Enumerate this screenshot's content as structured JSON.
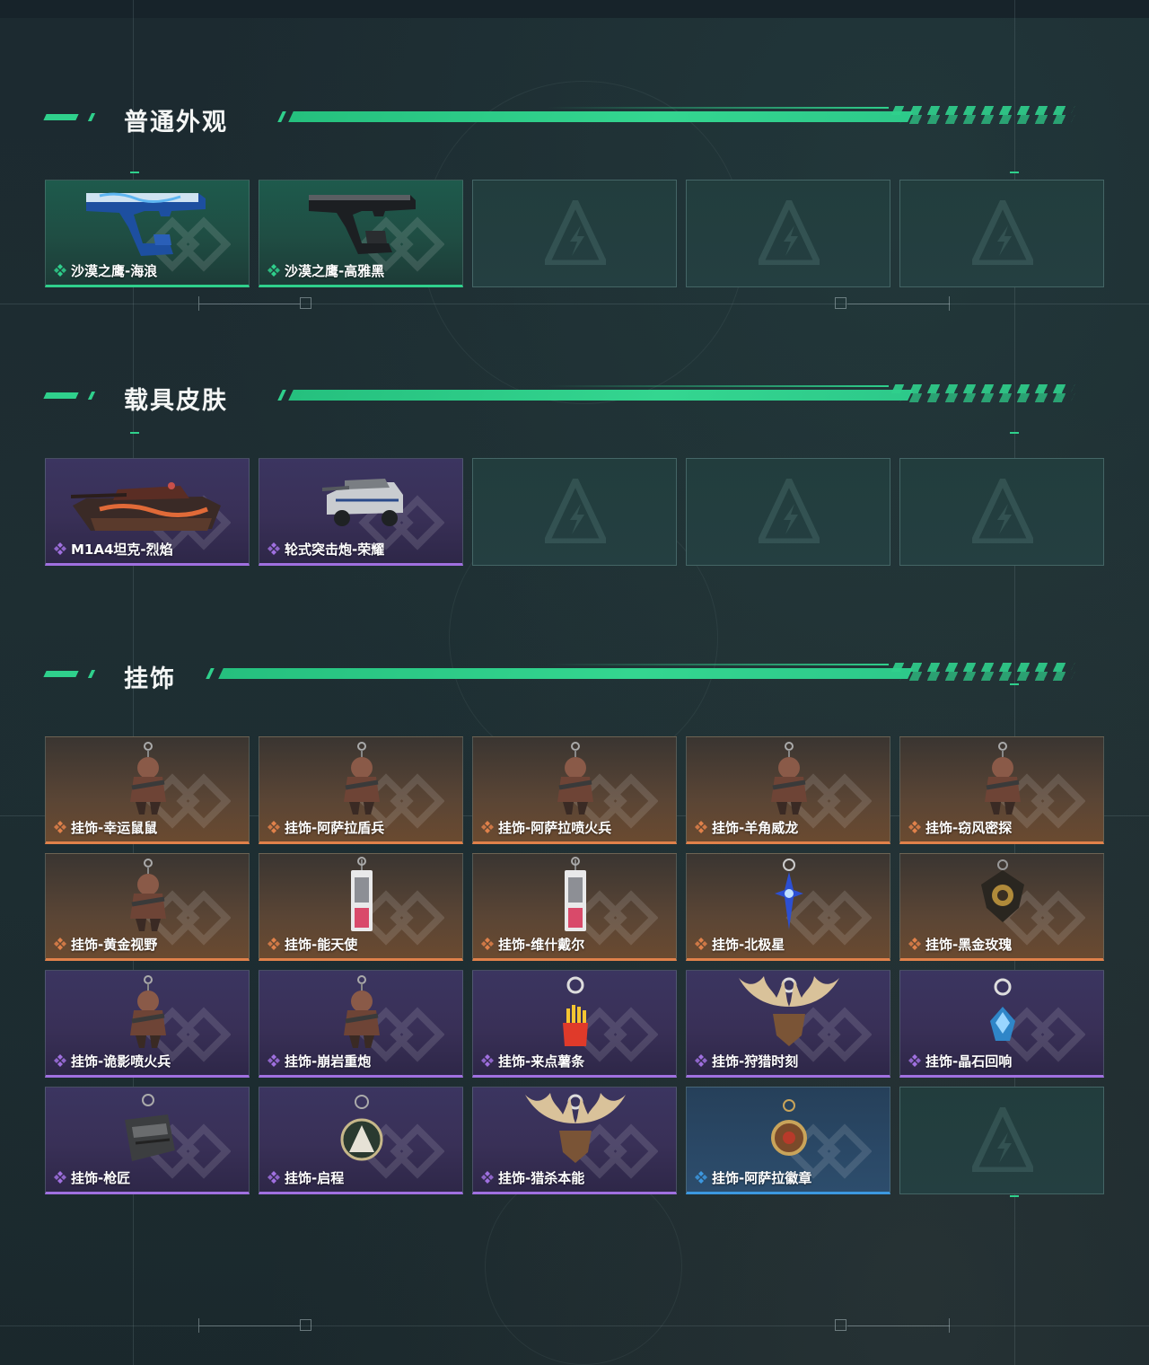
{
  "sections": [
    {
      "title": "普通外观",
      "cards": [
        {
          "label": "沙漠之鹰-海浪",
          "rarity": "green",
          "item_icon": "blue-pistol-icon"
        },
        {
          "label": "沙漠之鹰-高雅黑",
          "rarity": "green",
          "item_icon": "black-pistol-icon"
        },
        {
          "label": "",
          "rarity": "empty"
        },
        {
          "label": "",
          "rarity": "empty"
        },
        {
          "label": "",
          "rarity": "empty"
        }
      ]
    },
    {
      "title": "载具皮肤",
      "cards": [
        {
          "label": "M1A4坦克-烈焰",
          "rarity": "purple",
          "item_icon": "tank-icon"
        },
        {
          "label": "轮式突击炮-荣耀",
          "rarity": "purple",
          "item_icon": "armored-car-icon"
        },
        {
          "label": "",
          "rarity": "empty"
        },
        {
          "label": "",
          "rarity": "empty"
        },
        {
          "label": "",
          "rarity": "empty"
        }
      ]
    },
    {
      "title": "挂饰",
      "cards": [
        {
          "label": "挂饰-幸运鼠鼠",
          "rarity": "orange",
          "item_icon": "figure-charm-icon"
        },
        {
          "label": "挂饰-阿萨拉盾兵",
          "rarity": "orange",
          "item_icon": "figure-charm-icon"
        },
        {
          "label": "挂饰-阿萨拉喷火兵",
          "rarity": "orange",
          "item_icon": "figure-charm-icon"
        },
        {
          "label": "挂饰-羊角威龙",
          "rarity": "orange",
          "item_icon": "figure-charm-icon"
        },
        {
          "label": "挂饰-窃风密探",
          "rarity": "orange",
          "item_icon": "figure-charm-icon"
        },
        {
          "label": "挂饰-黄金视野",
          "rarity": "orange",
          "item_icon": "figure-charm-icon"
        },
        {
          "label": "挂饰-能天使",
          "rarity": "orange",
          "item_icon": "card-charm-icon"
        },
        {
          "label": "挂饰-维什戴尔",
          "rarity": "orange",
          "item_icon": "card-charm-icon"
        },
        {
          "label": "挂饰-北极星",
          "rarity": "orange",
          "item_icon": "star-charm-icon"
        },
        {
          "label": "挂饰-黑金玫瑰",
          "rarity": "orange",
          "item_icon": "rose-charm-icon"
        },
        {
          "label": "挂饰-诡影喷火兵",
          "rarity": "purple",
          "item_icon": "figure-charm-icon"
        },
        {
          "label": "挂饰-崩岩重炮",
          "rarity": "purple",
          "item_icon": "figure-charm-icon"
        },
        {
          "label": "挂饰-来点薯条",
          "rarity": "purple",
          "item_icon": "fries-charm-icon"
        },
        {
          "label": "挂饰-狩猎时刻",
          "rarity": "purple",
          "item_icon": "antler-charm-icon"
        },
        {
          "label": "挂饰-晶石回响",
          "rarity": "purple",
          "item_icon": "crystal-charm-icon"
        },
        {
          "label": "挂饰-枪匠",
          "rarity": "purple",
          "item_icon": "toolbox-charm-icon"
        },
        {
          "label": "挂饰-启程",
          "rarity": "purple",
          "item_icon": "medal-charm-icon"
        },
        {
          "label": "挂饰-猎杀本能",
          "rarity": "purple",
          "item_icon": "antler-charm-icon"
        },
        {
          "label": "挂饰-阿萨拉徽章",
          "rarity": "blue",
          "item_icon": "badge-charm-icon"
        },
        {
          "label": "",
          "rarity": "empty"
        }
      ]
    }
  ],
  "colors": {
    "accent_green": "#2fd08c",
    "rarity_green": "#2fd08c",
    "rarity_purple": "#a070e0",
    "rarity_orange": "#e0814a",
    "rarity_blue": "#3c98e0",
    "background": "#1e2c30"
  }
}
